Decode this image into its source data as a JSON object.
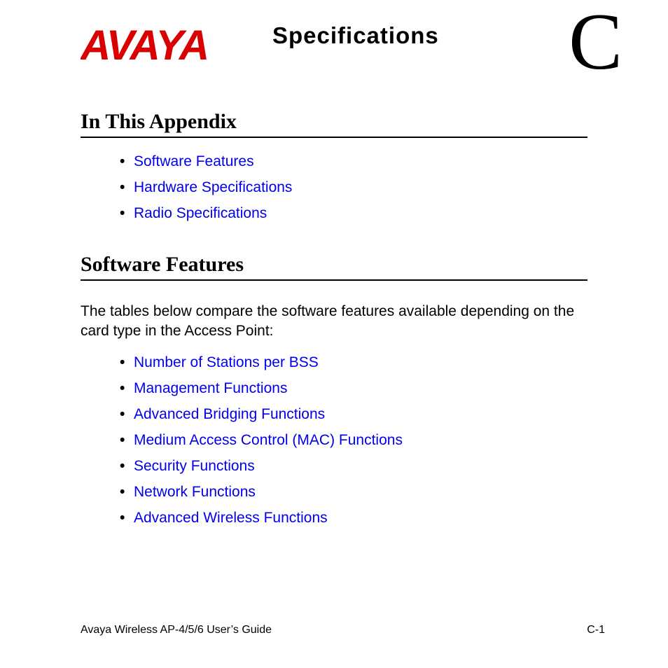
{
  "header": {
    "logo_text": "AVAYA",
    "title": "Specifications",
    "appendix_letter": "C"
  },
  "sections": {
    "appendix": {
      "heading": "In This Appendix",
      "links": [
        "Software Features",
        "Hardware Specifications",
        "Radio Specifications"
      ]
    },
    "software": {
      "heading": "Software Features",
      "body": "The tables below compare the software features available depending on the card type in the Access Point:",
      "links": [
        "Number of Stations per BSS",
        "Management Functions",
        "Advanced Bridging Functions",
        "Medium Access Control (MAC) Functions",
        "Security Functions",
        "Network Functions",
        "Advanced Wireless Functions"
      ]
    }
  },
  "footer": {
    "left": "Avaya Wireless AP-4/5/6 User’s Guide",
    "right": "C-1"
  }
}
